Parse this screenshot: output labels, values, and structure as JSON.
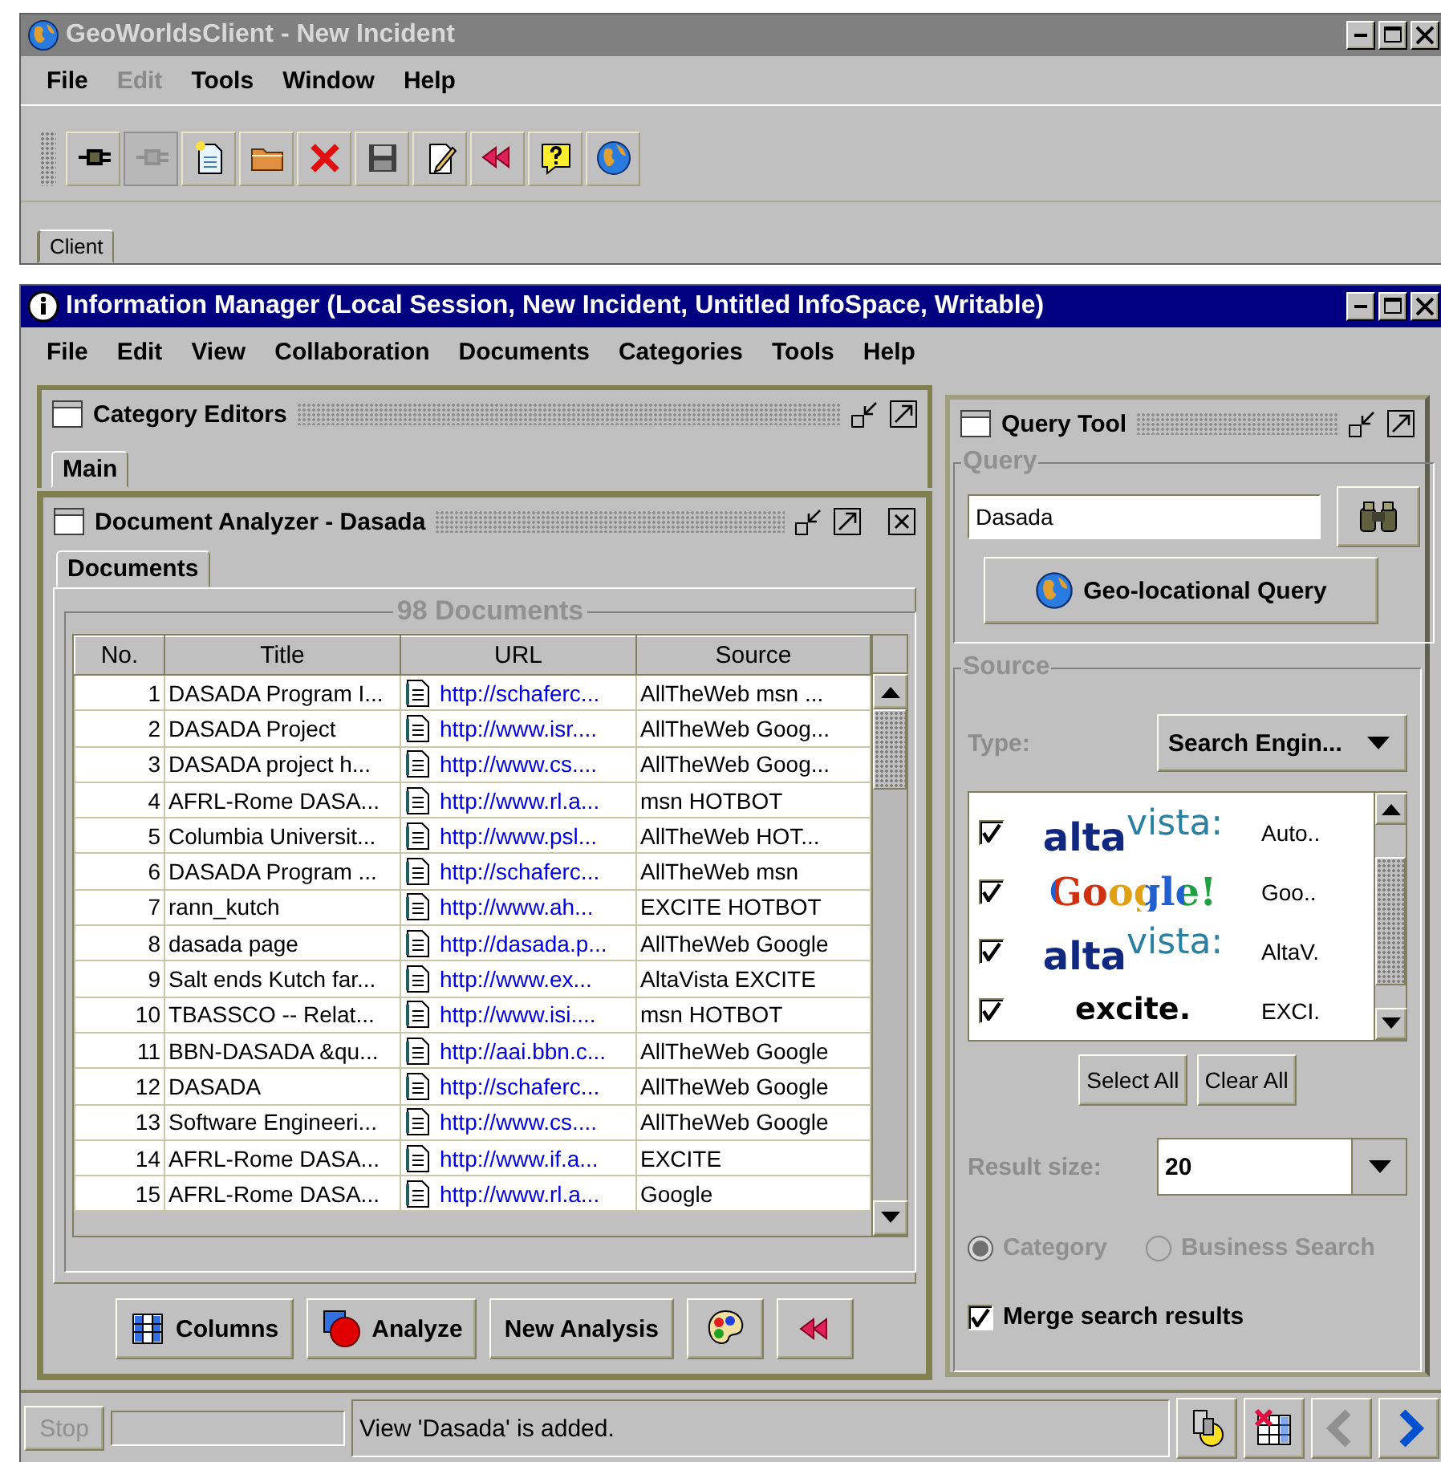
{
  "client_window": {
    "title": "GeoWorldsClient - New Incident",
    "menu": [
      {
        "label": "File",
        "disabled": false
      },
      {
        "label": "Edit",
        "disabled": true
      },
      {
        "label": "Tools",
        "disabled": false
      },
      {
        "label": "Window",
        "disabled": false
      },
      {
        "label": "Help",
        "disabled": false
      }
    ],
    "toolbar": [
      {
        "disabled": false
      },
      {
        "disabled": true
      },
      {
        "disabled": false
      },
      {
        "disabled": false
      },
      {
        "disabled": false
      },
      {
        "disabled": false
      },
      {
        "disabled": false
      },
      {
        "disabled": false
      },
      {
        "disabled": false
      },
      {
        "disabled": false
      }
    ],
    "tabs": [
      {
        "label": "Client",
        "selected": true
      }
    ]
  },
  "info_manager": {
    "title": "Information Manager (Local Session, New Incident, Untitled InfoSpace, Writable)",
    "menu": [
      "File",
      "Edit",
      "View",
      "Collaboration",
      "Documents",
      "Categories",
      "Tools",
      "Help"
    ]
  },
  "category_editors": {
    "title": "Category Editors",
    "tabs": [
      {
        "label": "Main",
        "selected": true
      }
    ]
  },
  "document_analyzer": {
    "title": "Document Analyzer - Dasada",
    "tabs": [
      {
        "label": "Documents",
        "selected": true
      }
    ],
    "group_title": "98 Documents",
    "table": {
      "columns": [
        "No.",
        "Title",
        "URL",
        "Source"
      ],
      "rows": [
        [
          "1",
          "DASADA Program I...",
          "http://schaferc...",
          "AllTheWeb msn ..."
        ],
        [
          "2",
          "DASADA Project",
          "http://www.isr....",
          "AllTheWeb Goog..."
        ],
        [
          "3",
          "DASADA project h...",
          "http://www.cs....",
          "AllTheWeb Goog..."
        ],
        [
          "4",
          "AFRL-Rome DASA...",
          "http://www.rl.a...",
          "msn HOTBOT"
        ],
        [
          "5",
          "Columbia Universit...",
          "http://www.psl...",
          "AllTheWeb HOT..."
        ],
        [
          "6",
          "DASADA Program ...",
          "http://schaferc...",
          "AllTheWeb msn"
        ],
        [
          "7",
          "rann_kutch",
          "http://www.ah...",
          "EXCITE HOTBOT"
        ],
        [
          "8",
          "dasada page",
          "http://dasada.p...",
          "AllTheWeb Google"
        ],
        [
          "9",
          "Salt ends Kutch far...",
          "http://www.ex...",
          "AltaVista EXCITE"
        ],
        [
          "10",
          "TBASSCO -- Relat...",
          "http://www.isi....",
          "msn HOTBOT"
        ],
        [
          "11",
          "BBN-DASADA &qu...",
          "http://aai.bbn.c...",
          "AllTheWeb Google"
        ],
        [
          "12",
          "DASADA",
          "http://schaferc...",
          "AllTheWeb Google"
        ],
        [
          "13",
          "Software Engineeri...",
          "http://www.cs....",
          "AllTheWeb Google"
        ],
        [
          "14",
          "AFRL-Rome DASA...",
          "http://www.if.a...",
          "EXCITE"
        ],
        [
          "15",
          "AFRL-Rome DASA...",
          "http://www.rl.a...",
          "Google"
        ]
      ]
    },
    "buttons": [
      "Columns",
      "Analyze",
      "New Analysis"
    ]
  },
  "query_tool": {
    "title": "Query Tool",
    "query_group": "Query",
    "query": "Dasada",
    "geo_button": "Geo-locational Query",
    "source_group": "Source",
    "type_label": "Type:",
    "type_value": "Search Engin...",
    "engines": [
      {
        "kind": "split",
        "logo": "alta$^{vista:}$",
        "name": "Auto..",
        "checked": true
      },
      {
        "kind": "multicolor",
        "logo": "Google!",
        "name": "Goo..",
        "checked": true
      },
      {
        "kind": "split",
        "logo": "alta$^{vista:}$",
        "name": "AltaV.",
        "checked": true
      },
      {
        "kind": "plain",
        "logo": "excite.",
        "name": "EXCI.",
        "checked": true
      }
    ],
    "select_all": "Select All",
    "clear_all": "Clear All",
    "result_size_label": "Result size:",
    "result_size": "20",
    "modes": [
      {
        "label": "Category",
        "selected": true,
        "disabled": true
      },
      {
        "label": "Business Search",
        "selected": false,
        "disabled": true
      }
    ],
    "merge": {
      "label": "Merge search results",
      "checked": true
    }
  },
  "status_bar": {
    "stop": "Stop",
    "progress": {
      "level": 0
    },
    "message": "View 'Dasada' is added.",
    "nav": [
      {
        "disabled": true
      },
      {
        "disabled": false
      }
    ]
  }
}
